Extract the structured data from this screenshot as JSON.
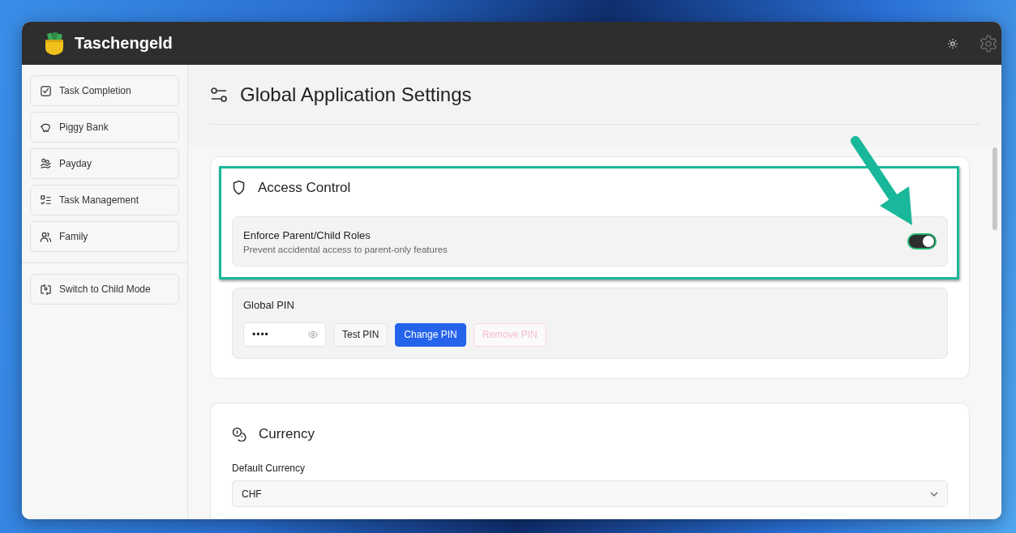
{
  "app": {
    "title": "Taschengeld"
  },
  "sidebar": {
    "items": [
      {
        "label": "Task Completion"
      },
      {
        "label": "Piggy Bank"
      },
      {
        "label": "Payday"
      },
      {
        "label": "Task Management"
      },
      {
        "label": "Family"
      }
    ],
    "footer_items": [
      {
        "label": "Switch to Child Mode"
      }
    ]
  },
  "page": {
    "title": "Global Application Settings"
  },
  "sections": [
    {
      "kind": "access",
      "title": "Access Control",
      "setting": {
        "label": "Enforce Parent/Child Roles",
        "description": "Prevent accidental access to parent-only features",
        "on": true
      },
      "pin": {
        "label": "Global PIN",
        "value": "••••",
        "buttons": [
          {
            "label": "Test PIN",
            "kind": "secondary",
            "disabled": false
          },
          {
            "label": "Change PIN",
            "kind": "primary",
            "disabled": false
          },
          {
            "label": "Remove PIN",
            "kind": "danger",
            "disabled": true
          }
        ]
      }
    },
    {
      "kind": "currency",
      "title": "Currency",
      "field_label": "Default Currency",
      "value": "CHF"
    }
  ]
}
